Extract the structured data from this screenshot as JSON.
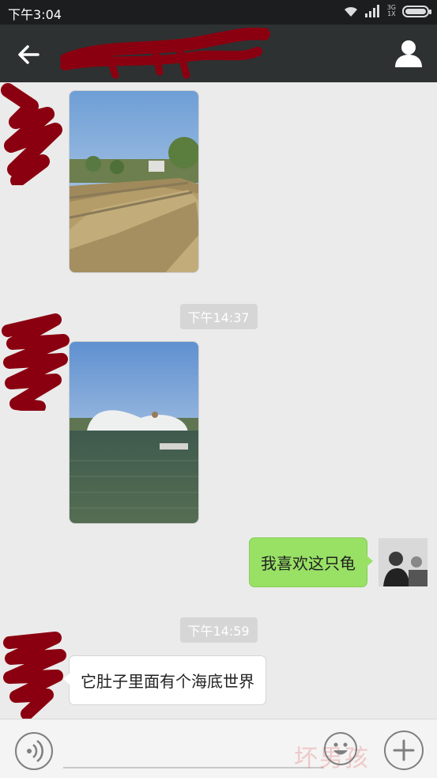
{
  "status_bar": {
    "time": "下午3:04",
    "network_top": "3G",
    "network_bottom": "1X"
  },
  "title_bar": {
    "back_icon": "arrow-left-icon",
    "contact_icon": "person-icon",
    "title_redacted": true
  },
  "messages": [
    {
      "type": "image",
      "side": "left",
      "scene": "stone-walkway-with-trees"
    },
    {
      "type": "timestamp",
      "text": "下午14:37"
    },
    {
      "type": "image",
      "side": "left",
      "scene": "lake-with-turtle-statue"
    },
    {
      "type": "text",
      "side": "right",
      "text": "我喜欢这只龟"
    },
    {
      "type": "timestamp",
      "text": "下午14:59"
    },
    {
      "type": "text",
      "side": "left",
      "text": "它肚子里面有个海底世界"
    }
  ],
  "input_bar": {
    "voice_icon": "voice-icon",
    "emoji_icon": "emoji-icon",
    "plus_icon": "plus-icon",
    "watermark": "坏男孩"
  },
  "colors": {
    "status_bar": "#1b1d1e",
    "title_bar": "#2e3132",
    "chat_bg": "#ebebeb",
    "my_bubble": "#98e165",
    "their_bubble": "#ffffff",
    "redaction": "#8b0010"
  }
}
